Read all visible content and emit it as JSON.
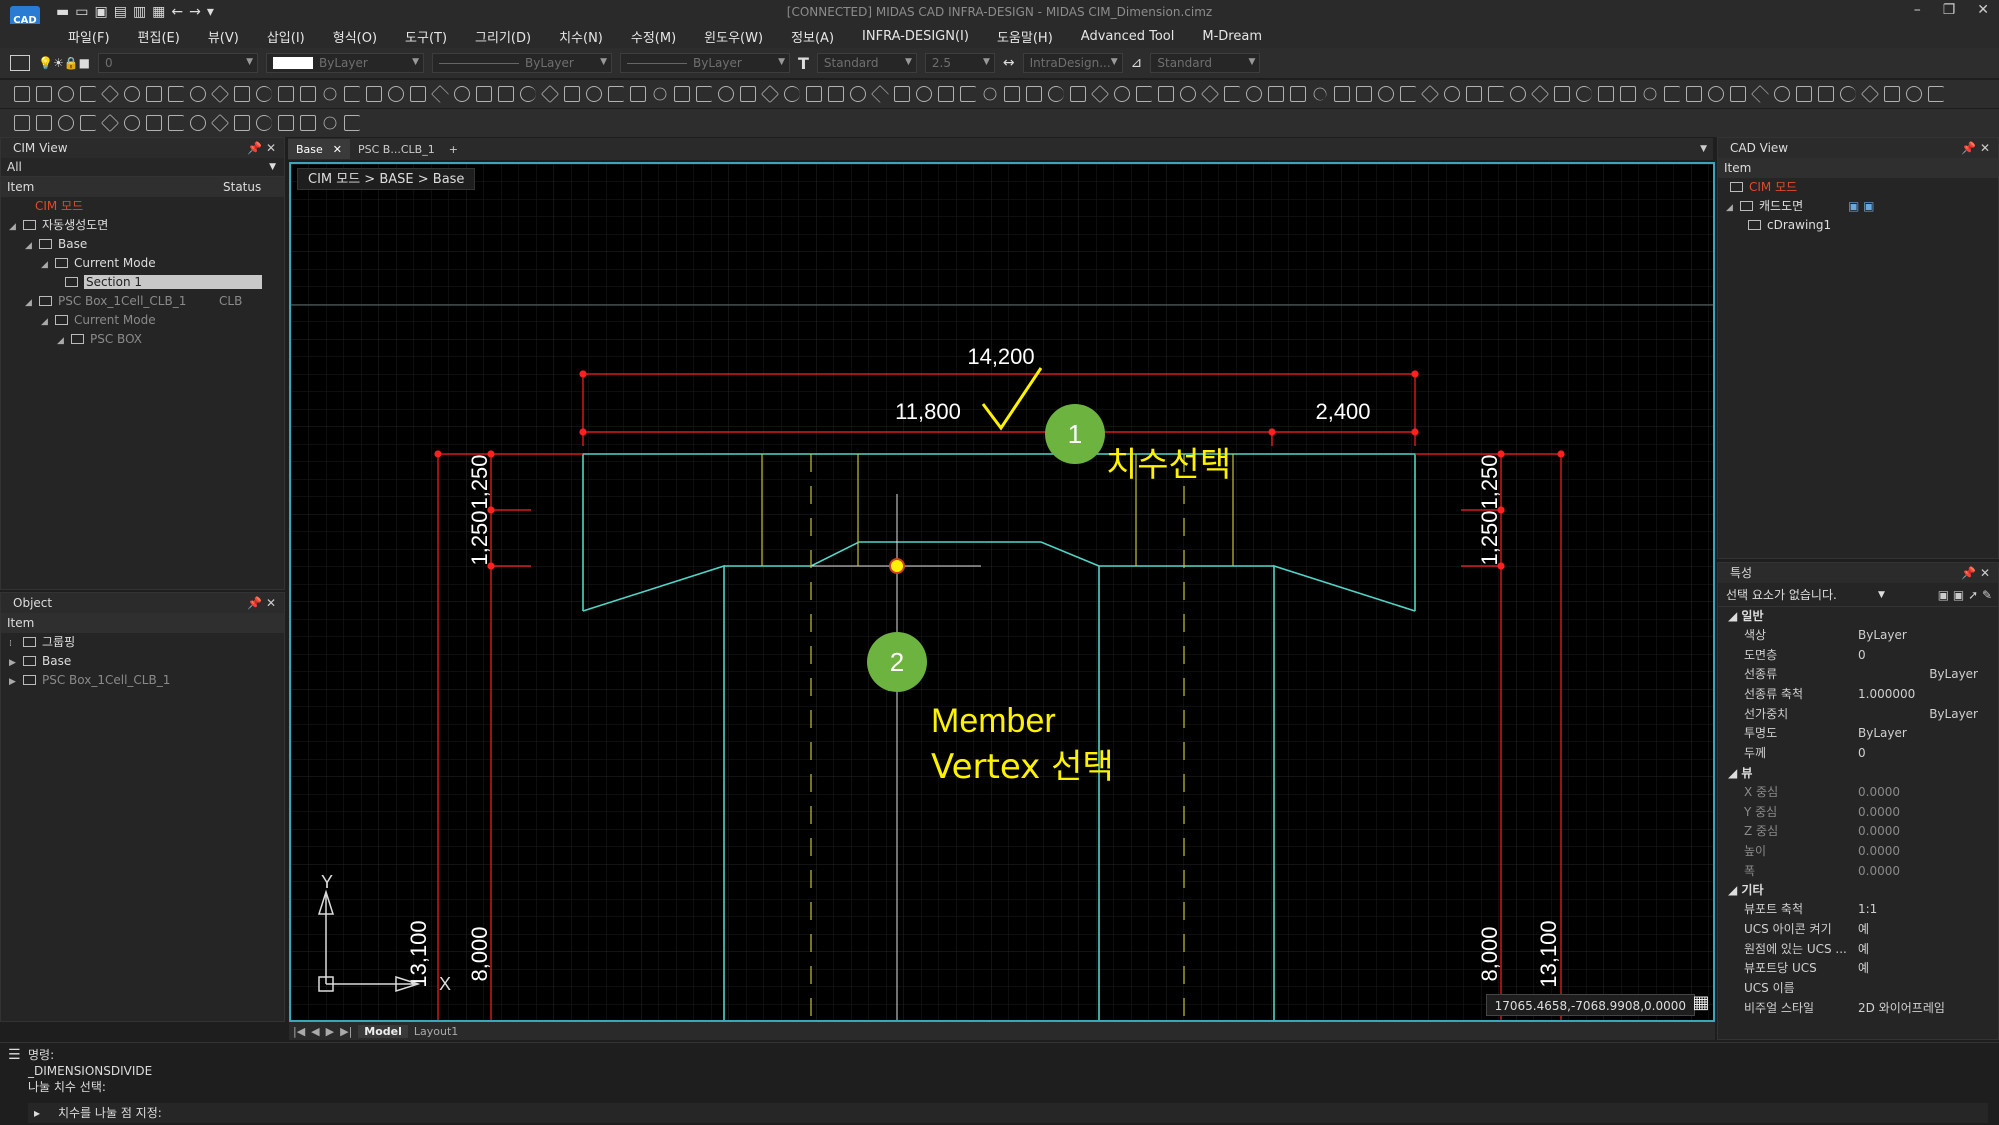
{
  "app": {
    "logo": "CAD",
    "title": "[CONNECTED] MIDAS CAD INFRA-DESIGN - MIDAS CIM_Dimension.cimz"
  },
  "menu": [
    "파일(F)",
    "편집(E)",
    "뷰(V)",
    "삽입(I)",
    "형식(O)",
    "도구(T)",
    "그리기(D)",
    "치수(N)",
    "수정(M)",
    "윈도우(W)",
    "정보(A)",
    "INFRA-DESIGN(I)",
    "도움말(H)",
    "Advanced Tool",
    "M-Dream"
  ],
  "propbar": {
    "layer_value": "0",
    "color_value": "ByLayer",
    "linetype_value": "ByLayer",
    "lineweight_value": "ByLayer",
    "textstyle_value": "Standard",
    "textheight_value": "2.5",
    "dimstyle_value": "IntraDesign...",
    "tablestyle_value": "Standard"
  },
  "cim_view": {
    "title": "CIM View",
    "filter": "All",
    "col_item": "Item",
    "col_status": "Status",
    "items": [
      {
        "label": "CIM 모드",
        "level": 0,
        "kind": "root"
      },
      {
        "label": "자동생성도면",
        "level": 0,
        "kind": "group"
      },
      {
        "label": "Base",
        "level": 1,
        "kind": "node"
      },
      {
        "label": "Current Mode",
        "level": 2,
        "kind": "node"
      },
      {
        "label": "Section 1",
        "level": 3,
        "kind": "selected"
      },
      {
        "label": "PSC Box_1Cell_CLB_1",
        "level": 1,
        "kind": "dim",
        "status": "CLB"
      },
      {
        "label": "Current Mode",
        "level": 2,
        "kind": "dim"
      },
      {
        "label": "PSC BOX",
        "level": 3,
        "kind": "dim"
      }
    ]
  },
  "object_panel": {
    "title": "Object",
    "col_item": "Item",
    "items": [
      {
        "label": "그룹핑"
      },
      {
        "label": "Base"
      },
      {
        "label": "PSC Box_1Cell_CLB_1",
        "dim": true
      }
    ]
  },
  "tabs": [
    {
      "label": "Base",
      "active": true
    },
    {
      "label": "PSC B...CLB_1",
      "active": false
    }
  ],
  "viewport": {
    "breadcrumb": "CIM 모드 > BASE > Base",
    "coords": "17065.4658,-7068.9908,0.0000",
    "ucs_y": "Y",
    "ucs_x": "X",
    "dims": {
      "top_total": "14,200",
      "top_left": "11,800",
      "top_right": "2,400",
      "left_v1": "1,250",
      "left_v2": "1,250",
      "right_v1": "1,250",
      "right_v2": "1,250",
      "left_8000": "8,000",
      "left_13100": "13,100",
      "right_8000": "8,000",
      "right_13100": "13,100"
    },
    "annotations": {
      "step1_num": "1",
      "step1_text": "치수선택",
      "step2_num": "2",
      "step2_line1": "Member",
      "step2_line2": "Vertex 선택"
    },
    "colors": {
      "accent_yellow": "#fff200",
      "step_green": "#6db33f",
      "dim_red": "#ff2020",
      "member_cyan": "#4fd6c8"
    }
  },
  "layout_tabs": {
    "model": "Model",
    "layout1": "Layout1"
  },
  "cad_view": {
    "title": "CAD View",
    "col_item": "Item",
    "items": [
      {
        "label": "CIM 모드",
        "red": true
      },
      {
        "label": "캐드도면"
      },
      {
        "label": "cDrawing1"
      }
    ]
  },
  "properties": {
    "title": "특성",
    "selection": "선택 요소가 없습니다.",
    "sections": [
      {
        "name": "일반",
        "rows": [
          {
            "k": "색상",
            "v": "ByLayer"
          },
          {
            "k": "도면층",
            "v": "0"
          },
          {
            "k": "선종류",
            "v": "ByLayer"
          },
          {
            "k": "선종류 축척",
            "v": "1.000000"
          },
          {
            "k": "선가중치",
            "v": "ByLayer"
          },
          {
            "k": "투명도",
            "v": "ByLayer"
          },
          {
            "k": "두께",
            "v": "0"
          }
        ]
      },
      {
        "name": "뷰",
        "rows": [
          {
            "k": "X 중심",
            "v": "0.0000"
          },
          {
            "k": "Y 중심",
            "v": "0.0000"
          },
          {
            "k": "Z 중심",
            "v": "0.0000"
          },
          {
            "k": "높이",
            "v": "0.0000"
          },
          {
            "k": "폭",
            "v": "0.0000"
          }
        ]
      },
      {
        "name": "기타",
        "rows": [
          {
            "k": "뷰포트 축척",
            "v": "1:1"
          },
          {
            "k": "UCS 아이콘 켜기",
            "v": "예"
          },
          {
            "k": "원점에 있는 UCS ...",
            "v": "예"
          },
          {
            "k": "뷰포트당 UCS",
            "v": "예"
          },
          {
            "k": "UCS 이름",
            "v": ""
          },
          {
            "k": "비주얼 스타일",
            "v": "2D 와이어프레임"
          }
        ]
      }
    ]
  },
  "command": {
    "lines": [
      "명령:",
      "_DIMENSIONSDIVIDE",
      "나눌 치수 선택:"
    ],
    "prompt": "치수를 나눌 점 지정:"
  }
}
